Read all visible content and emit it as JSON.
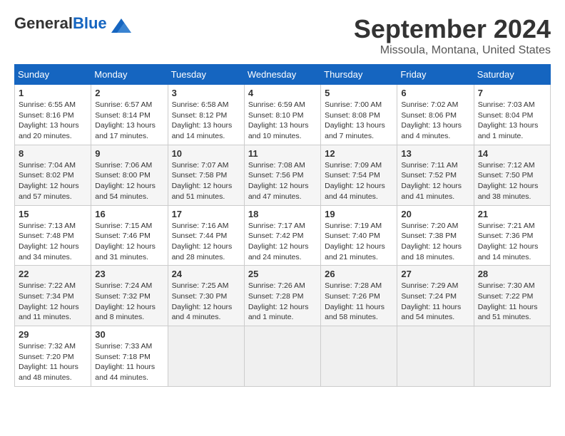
{
  "header": {
    "logo_general": "General",
    "logo_blue": "Blue",
    "month_title": "September 2024",
    "location": "Missoula, Montana, United States"
  },
  "days_of_week": [
    "Sunday",
    "Monday",
    "Tuesday",
    "Wednesday",
    "Thursday",
    "Friday",
    "Saturday"
  ],
  "weeks": [
    [
      {
        "day": 1,
        "sunrise": "6:55 AM",
        "sunset": "8:16 PM",
        "daylight": "13 hours and 20 minutes."
      },
      {
        "day": 2,
        "sunrise": "6:57 AM",
        "sunset": "8:14 PM",
        "daylight": "13 hours and 17 minutes."
      },
      {
        "day": 3,
        "sunrise": "6:58 AM",
        "sunset": "8:12 PM",
        "daylight": "13 hours and 14 minutes."
      },
      {
        "day": 4,
        "sunrise": "6:59 AM",
        "sunset": "8:10 PM",
        "daylight": "13 hours and 10 minutes."
      },
      {
        "day": 5,
        "sunrise": "7:00 AM",
        "sunset": "8:08 PM",
        "daylight": "13 hours and 7 minutes."
      },
      {
        "day": 6,
        "sunrise": "7:02 AM",
        "sunset": "8:06 PM",
        "daylight": "13 hours and 4 minutes."
      },
      {
        "day": 7,
        "sunrise": "7:03 AM",
        "sunset": "8:04 PM",
        "daylight": "13 hours and 1 minute."
      }
    ],
    [
      {
        "day": 8,
        "sunrise": "7:04 AM",
        "sunset": "8:02 PM",
        "daylight": "12 hours and 57 minutes."
      },
      {
        "day": 9,
        "sunrise": "7:06 AM",
        "sunset": "8:00 PM",
        "daylight": "12 hours and 54 minutes."
      },
      {
        "day": 10,
        "sunrise": "7:07 AM",
        "sunset": "7:58 PM",
        "daylight": "12 hours and 51 minutes."
      },
      {
        "day": 11,
        "sunrise": "7:08 AM",
        "sunset": "7:56 PM",
        "daylight": "12 hours and 47 minutes."
      },
      {
        "day": 12,
        "sunrise": "7:09 AM",
        "sunset": "7:54 PM",
        "daylight": "12 hours and 44 minutes."
      },
      {
        "day": 13,
        "sunrise": "7:11 AM",
        "sunset": "7:52 PM",
        "daylight": "12 hours and 41 minutes."
      },
      {
        "day": 14,
        "sunrise": "7:12 AM",
        "sunset": "7:50 PM",
        "daylight": "12 hours and 38 minutes."
      }
    ],
    [
      {
        "day": 15,
        "sunrise": "7:13 AM",
        "sunset": "7:48 PM",
        "daylight": "12 hours and 34 minutes."
      },
      {
        "day": 16,
        "sunrise": "7:15 AM",
        "sunset": "7:46 PM",
        "daylight": "12 hours and 31 minutes."
      },
      {
        "day": 17,
        "sunrise": "7:16 AM",
        "sunset": "7:44 PM",
        "daylight": "12 hours and 28 minutes."
      },
      {
        "day": 18,
        "sunrise": "7:17 AM",
        "sunset": "7:42 PM",
        "daylight": "12 hours and 24 minutes."
      },
      {
        "day": 19,
        "sunrise": "7:19 AM",
        "sunset": "7:40 PM",
        "daylight": "12 hours and 21 minutes."
      },
      {
        "day": 20,
        "sunrise": "7:20 AM",
        "sunset": "7:38 PM",
        "daylight": "12 hours and 18 minutes."
      },
      {
        "day": 21,
        "sunrise": "7:21 AM",
        "sunset": "7:36 PM",
        "daylight": "12 hours and 14 minutes."
      }
    ],
    [
      {
        "day": 22,
        "sunrise": "7:22 AM",
        "sunset": "7:34 PM",
        "daylight": "12 hours and 11 minutes."
      },
      {
        "day": 23,
        "sunrise": "7:24 AM",
        "sunset": "7:32 PM",
        "daylight": "12 hours and 8 minutes."
      },
      {
        "day": 24,
        "sunrise": "7:25 AM",
        "sunset": "7:30 PM",
        "daylight": "12 hours and 4 minutes."
      },
      {
        "day": 25,
        "sunrise": "7:26 AM",
        "sunset": "7:28 PM",
        "daylight": "12 hours and 1 minute."
      },
      {
        "day": 26,
        "sunrise": "7:28 AM",
        "sunset": "7:26 PM",
        "daylight": "11 hours and 58 minutes."
      },
      {
        "day": 27,
        "sunrise": "7:29 AM",
        "sunset": "7:24 PM",
        "daylight": "11 hours and 54 minutes."
      },
      {
        "day": 28,
        "sunrise": "7:30 AM",
        "sunset": "7:22 PM",
        "daylight": "11 hours and 51 minutes."
      }
    ],
    [
      {
        "day": 29,
        "sunrise": "7:32 AM",
        "sunset": "7:20 PM",
        "daylight": "11 hours and 48 minutes."
      },
      {
        "day": 30,
        "sunrise": "7:33 AM",
        "sunset": "7:18 PM",
        "daylight": "11 hours and 44 minutes."
      },
      null,
      null,
      null,
      null,
      null
    ]
  ]
}
